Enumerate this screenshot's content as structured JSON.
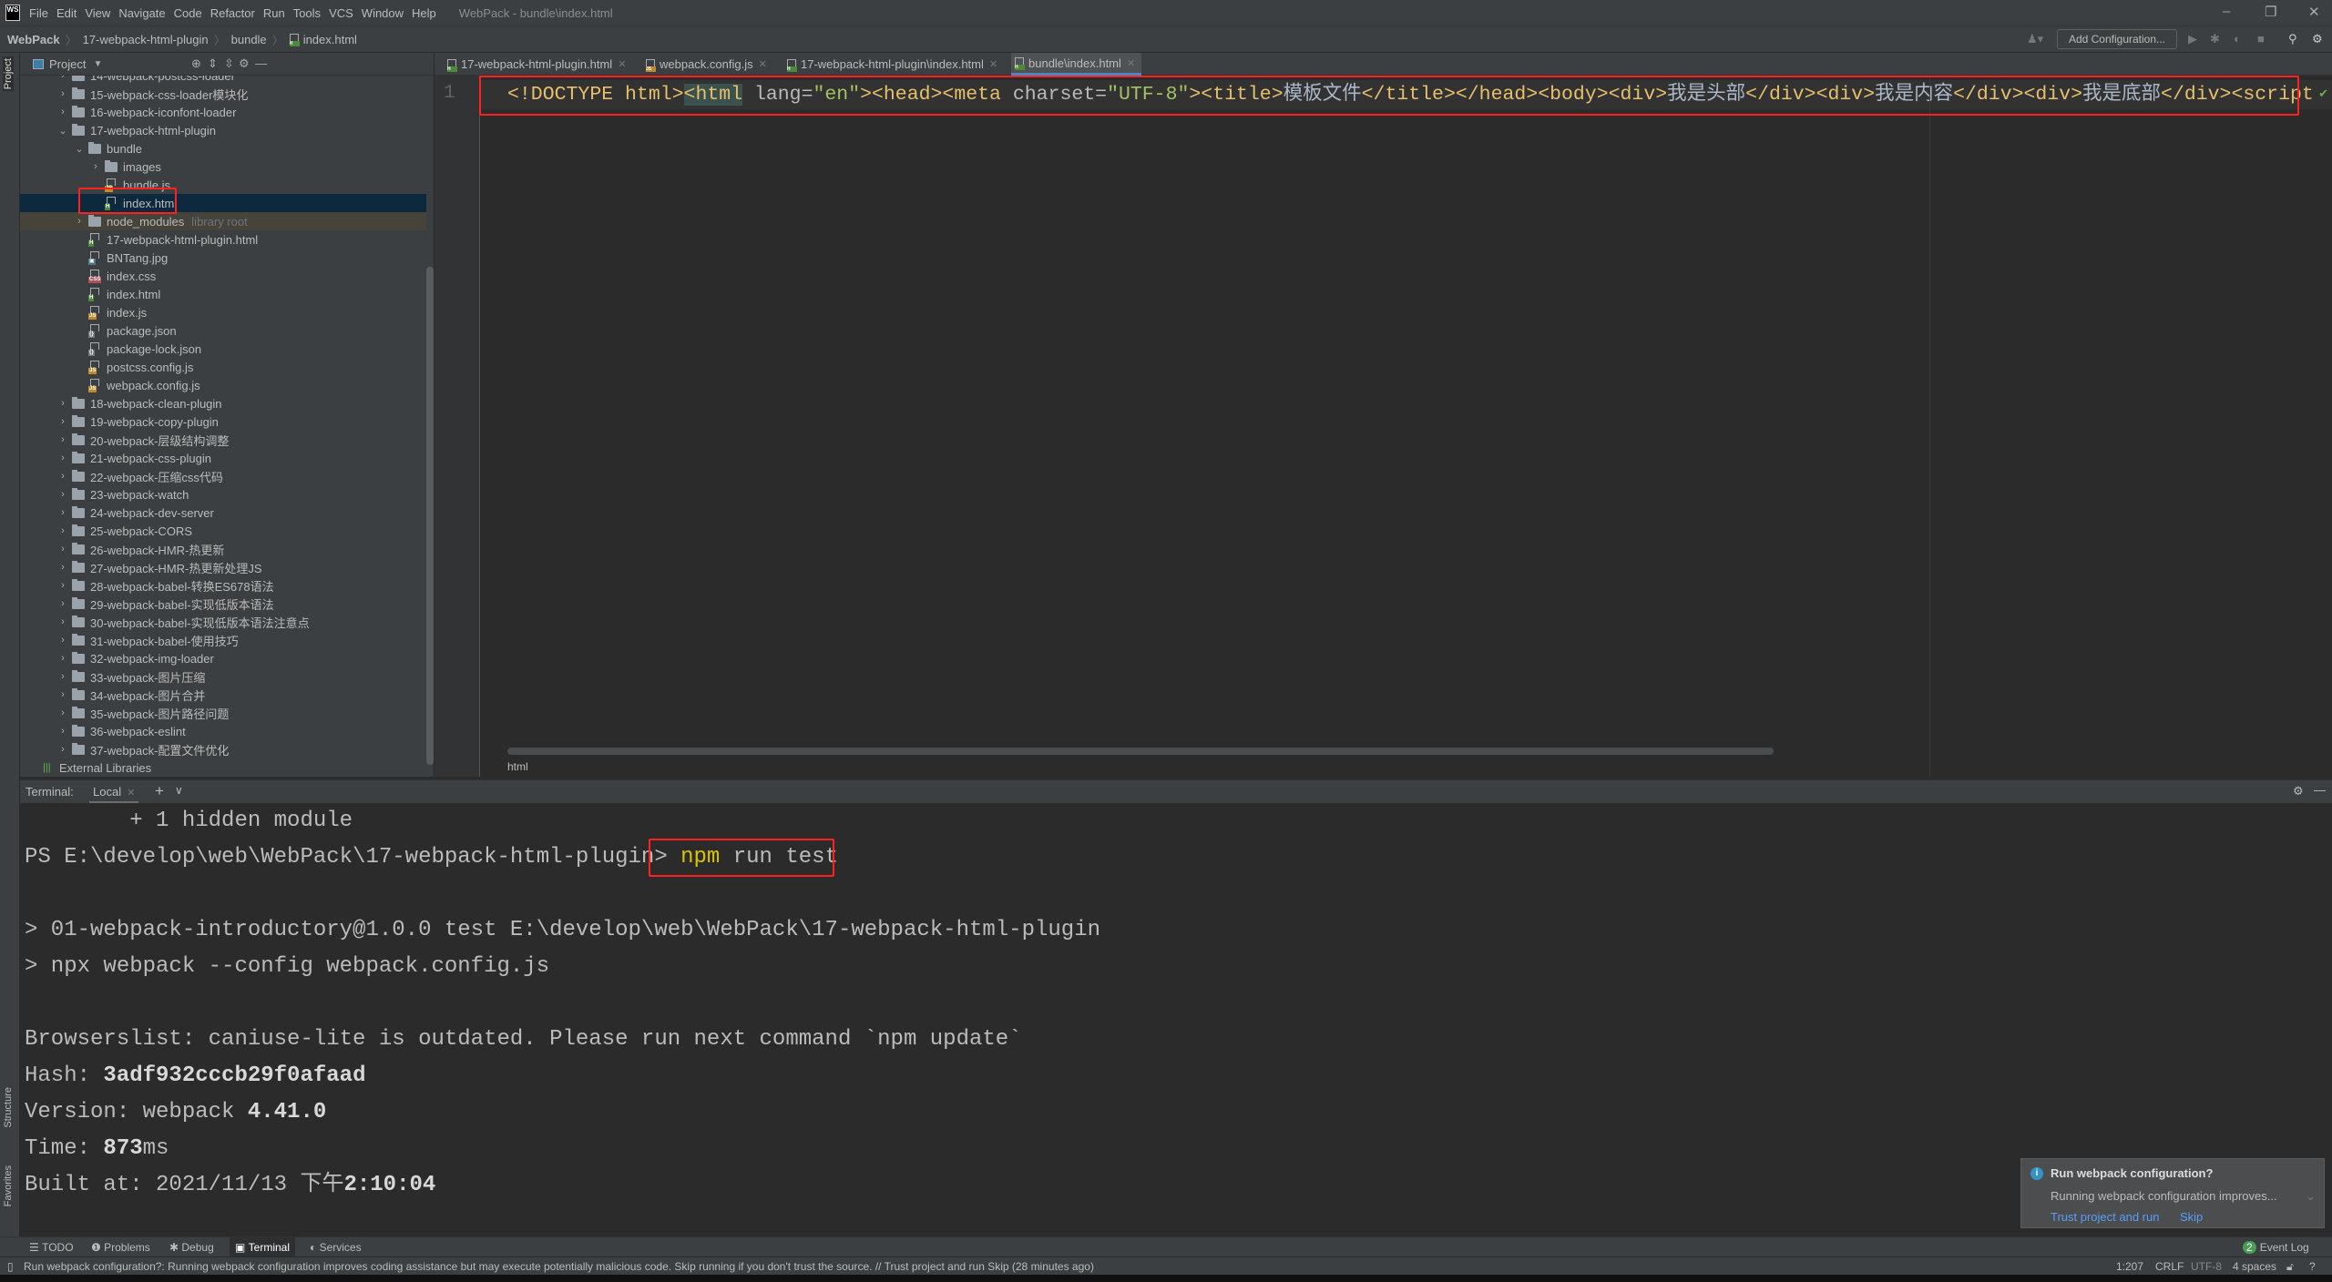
{
  "menubar": {
    "logo": "WS",
    "items": [
      "File",
      "Edit",
      "View",
      "Navigate",
      "Code",
      "Refactor",
      "Run",
      "Tools",
      "VCS",
      "Window",
      "Help"
    ],
    "window_title": "WebPack - bundle\\index.html"
  },
  "navbar": {
    "crumbs": [
      "WebPack",
      "17-webpack-html-plugin",
      "bundle",
      "index.html"
    ],
    "add_configuration": "Add Configuration..."
  },
  "left_stripe": {
    "project": "Project",
    "structure": "Structure",
    "favorites": "Favorites"
  },
  "project": {
    "title": "Project",
    "tree": [
      {
        "label": "14-webpack-postcss-loader",
        "level": 1,
        "type": "folder",
        "state": "collapsed"
      },
      {
        "label": "15-webpack-css-loader模块化",
        "level": 1,
        "type": "folder",
        "state": "collapsed"
      },
      {
        "label": "16-webpack-iconfont-loader",
        "level": 1,
        "type": "folder",
        "state": "collapsed"
      },
      {
        "label": "17-webpack-html-plugin",
        "level": 1,
        "type": "folder",
        "state": "expanded"
      },
      {
        "label": "bundle",
        "level": 2,
        "type": "folder",
        "state": "expanded"
      },
      {
        "label": "images",
        "level": 3,
        "type": "folder",
        "state": "collapsed"
      },
      {
        "label": "bundle.js",
        "level": 3,
        "type": "js"
      },
      {
        "label": "index.html",
        "level": 3,
        "type": "html",
        "selected": true
      },
      {
        "label": "node_modules",
        "hint": "library root",
        "level": 2,
        "type": "folder",
        "state": "collapsed"
      },
      {
        "label": "17-webpack-html-plugin.html",
        "level": 2,
        "type": "html"
      },
      {
        "label": "BNTang.jpg",
        "level": 2,
        "type": "image"
      },
      {
        "label": "index.css",
        "level": 2,
        "type": "css"
      },
      {
        "label": "index.html",
        "level": 2,
        "type": "html"
      },
      {
        "label": "index.js",
        "level": 2,
        "type": "js"
      },
      {
        "label": "package.json",
        "level": 2,
        "type": "json"
      },
      {
        "label": "package-lock.json",
        "level": 2,
        "type": "json"
      },
      {
        "label": "postcss.config.js",
        "level": 2,
        "type": "js"
      },
      {
        "label": "webpack.config.js",
        "level": 2,
        "type": "js"
      },
      {
        "label": "18-webpack-clean-plugin",
        "level": 1,
        "type": "folder",
        "state": "collapsed"
      },
      {
        "label": "19-webpack-copy-plugin",
        "level": 1,
        "type": "folder",
        "state": "collapsed"
      },
      {
        "label": "20-webpack-层级结构调整",
        "level": 1,
        "type": "folder",
        "state": "collapsed"
      },
      {
        "label": "21-webpack-css-plugin",
        "level": 1,
        "type": "folder",
        "state": "collapsed"
      },
      {
        "label": "22-webpack-压缩css代码",
        "level": 1,
        "type": "folder",
        "state": "collapsed"
      },
      {
        "label": "23-webpack-watch",
        "level": 1,
        "type": "folder",
        "state": "collapsed"
      },
      {
        "label": "24-webpack-dev-server",
        "level": 1,
        "type": "folder",
        "state": "collapsed"
      },
      {
        "label": "25-webpack-CORS",
        "level": 1,
        "type": "folder",
        "state": "collapsed"
      },
      {
        "label": "26-webpack-HMR-热更新",
        "level": 1,
        "type": "folder",
        "state": "collapsed"
      },
      {
        "label": "27-webpack-HMR-热更新处理JS",
        "level": 1,
        "type": "folder",
        "state": "collapsed"
      },
      {
        "label": "28-webpack-babel-转换ES678语法",
        "level": 1,
        "type": "folder",
        "state": "collapsed"
      },
      {
        "label": "29-webpack-babel-实现低版本语法",
        "level": 1,
        "type": "folder",
        "state": "collapsed"
      },
      {
        "label": "30-webpack-babel-实现低版本语法注意点",
        "level": 1,
        "type": "folder",
        "state": "collapsed"
      },
      {
        "label": "31-webpack-babel-使用技巧",
        "level": 1,
        "type": "folder",
        "state": "collapsed"
      },
      {
        "label": "32-webpack-img-loader",
        "level": 1,
        "type": "folder",
        "state": "collapsed"
      },
      {
        "label": "33-webpack-图片压缩",
        "level": 1,
        "type": "folder",
        "state": "collapsed"
      },
      {
        "label": "34-webpack-图片合并",
        "level": 1,
        "type": "folder",
        "state": "collapsed"
      },
      {
        "label": "35-webpack-图片路径问题",
        "level": 1,
        "type": "folder",
        "state": "collapsed"
      },
      {
        "label": "36-webpack-eslint",
        "level": 1,
        "type": "folder",
        "state": "collapsed"
      },
      {
        "label": "37-webpack-配置文件优化",
        "level": 1,
        "type": "folder",
        "state": "collapsed"
      },
      {
        "label": "External Libraries",
        "level": 0,
        "type": "libraries"
      }
    ]
  },
  "editor": {
    "tabs": [
      {
        "label": "17-webpack-html-plugin.html",
        "type": "html"
      },
      {
        "label": "webpack.config.js",
        "type": "js"
      },
      {
        "label": "17-webpack-html-plugin\\index.html",
        "type": "html"
      },
      {
        "label": "bundle\\index.html",
        "type": "html",
        "active": true
      }
    ],
    "line_number": "1",
    "tokens": [
      {
        "t": "<!DOCTYPE html>",
        "k": "tag"
      },
      {
        "t": "<html",
        "k": "hl"
      },
      {
        "t": " lang",
        "k": "attr"
      },
      {
        "t": "=",
        "k": "attr"
      },
      {
        "t": "\"en\"",
        "k": "val"
      },
      {
        "t": ">",
        "k": "tag"
      },
      {
        "t": "<head>",
        "k": "tag"
      },
      {
        "t": "<meta",
        "k": "tag"
      },
      {
        "t": " charset",
        "k": "attr"
      },
      {
        "t": "=",
        "k": "attr"
      },
      {
        "t": "\"UTF-8\"",
        "k": "val"
      },
      {
        "t": ">",
        "k": "tag"
      },
      {
        "t": "<title>",
        "k": "tag"
      },
      {
        "t": "模板文件",
        "k": "text"
      },
      {
        "t": "</title>",
        "k": "tag"
      },
      {
        "t": "</head>",
        "k": "tag"
      },
      {
        "t": "<body>",
        "k": "tag"
      },
      {
        "t": "<div>",
        "k": "tag"
      },
      {
        "t": "我是头部",
        "k": "text"
      },
      {
        "t": "</div>",
        "k": "tag"
      },
      {
        "t": "<div>",
        "k": "tag"
      },
      {
        "t": "我是内容",
        "k": "text"
      },
      {
        "t": "</div>",
        "k": "tag"
      },
      {
        "t": "<div>",
        "k": "tag"
      },
      {
        "t": "我是底部",
        "k": "text"
      },
      {
        "t": "</div>",
        "k": "tag"
      },
      {
        "t": "<script",
        "k": "tag"
      }
    ],
    "breadcrumb": "html"
  },
  "terminal": {
    "label": "Terminal:",
    "tab": "Local",
    "lines": [
      [
        {
          "t": "        + 1 hidden module"
        }
      ],
      [
        {
          "t": "PS E:\\develop\\web\\WebPack\\17-webpack-html-plugin> "
        },
        {
          "t": "npm",
          "c": "npm"
        },
        {
          "t": " run test"
        }
      ],
      [],
      [
        {
          "t": "> 01-webpack-introductory@1.0.0 test E:\\develop\\web\\WebPack\\17-webpack-html-plugin"
        }
      ],
      [
        {
          "t": "> npx webpack --config webpack.config.js"
        }
      ],
      [],
      [
        {
          "t": "Browserslist: caniuse-lite is outdated. Please run next command `npm update`"
        }
      ],
      [
        {
          "t": "Hash: "
        },
        {
          "t": "3adf932cccb29f0afaad",
          "c": "bold"
        }
      ],
      [
        {
          "t": "Version: webpack "
        },
        {
          "t": "4.41.0",
          "c": "bold"
        }
      ],
      [
        {
          "t": "Time: "
        },
        {
          "t": "873",
          "c": "bold"
        },
        {
          "t": "ms"
        }
      ],
      [
        {
          "t": "Built at: 2021/11/13 下午"
        },
        {
          "t": "2:10:04",
          "c": "bold"
        }
      ]
    ]
  },
  "notification": {
    "title": "Run webpack configuration?",
    "body": "Running webpack configuration improves...",
    "action_trust": "Trust project and run",
    "action_skip": "Skip"
  },
  "bottom_tools": {
    "todo": "TODO",
    "problems": "Problems",
    "debug": "Debug",
    "terminal": "Terminal",
    "services": "Services",
    "event_log": "Event Log",
    "event_count": "2"
  },
  "statusbar": {
    "message": "Run webpack configuration?: Running webpack configuration improves coding assistance but may execute potentially malicious code. Skip running if you don't trust the source. // Trust project and run   Skip (28 minutes ago)",
    "position": "1:207",
    "line_sep": "CRLF",
    "encoding": "UTF-8",
    "indent": "4 spaces"
  },
  "colors": {
    "highlight_box": "#ff2020",
    "selection": "#0d293e",
    "accent": "#4a88c7",
    "npm": "#d6c400"
  }
}
